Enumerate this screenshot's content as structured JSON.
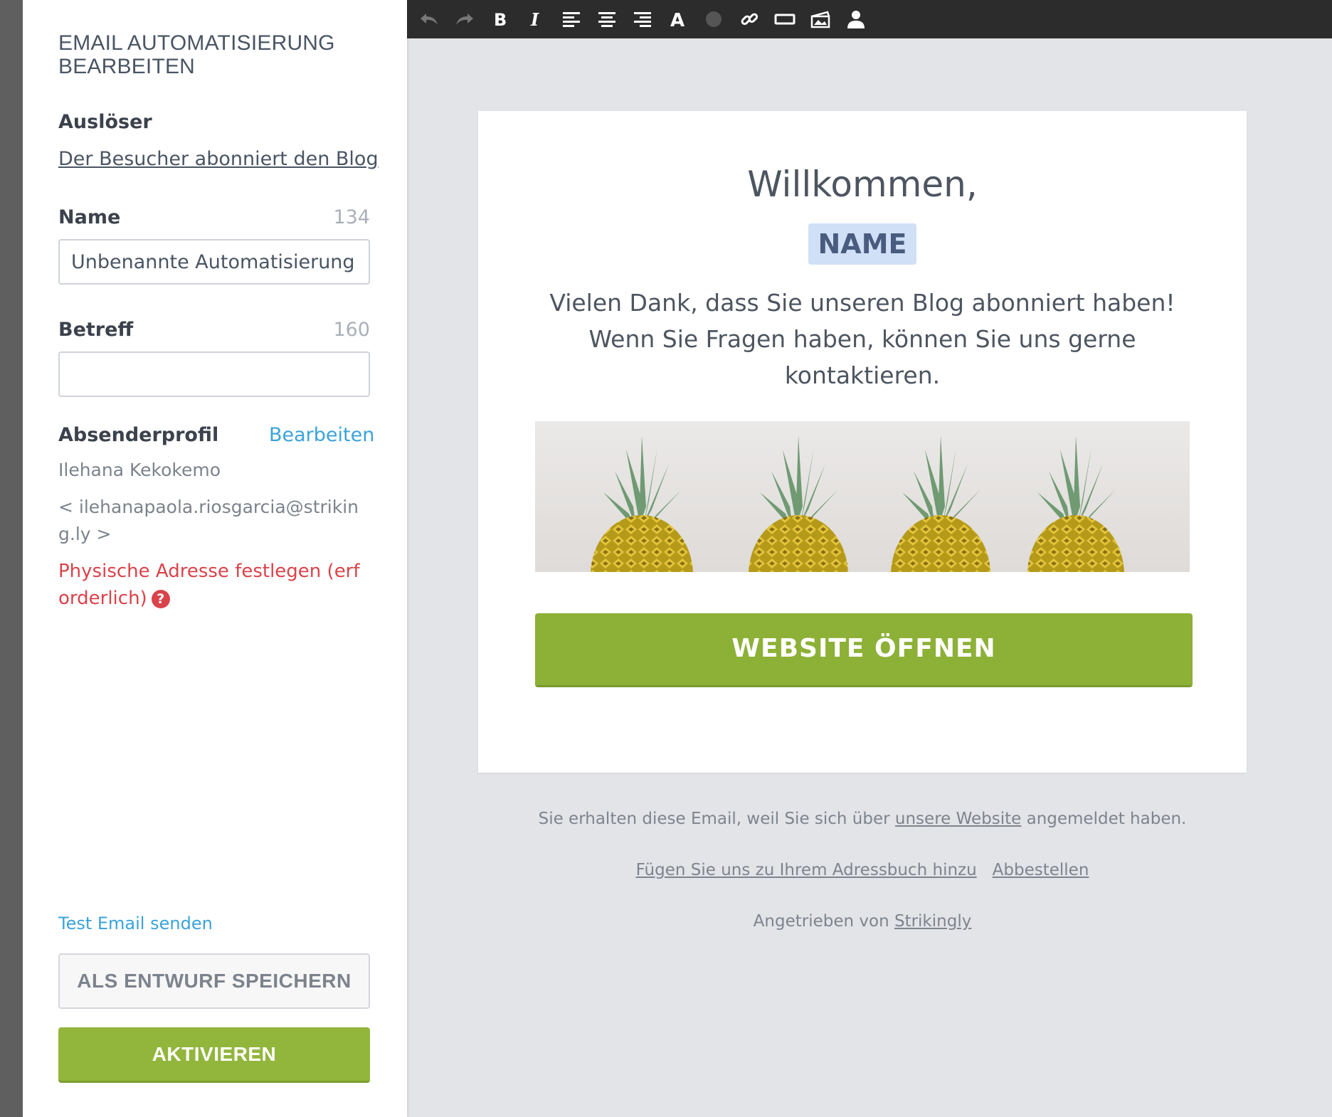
{
  "sidebar": {
    "title": "EMAIL AUTOMATISIERUNG BEARBEITEN",
    "trigger_label": "Auslöser",
    "trigger_value": "Der Besucher abonniert den Blog",
    "name_label": "Name",
    "name_count": "134",
    "name_value": "Unbenannte Automatisierung",
    "subject_label": "Betreff",
    "subject_count": "160",
    "subject_value": "",
    "sender_label": "Absenderprofil",
    "sender_edit": "Bearbeiten",
    "sender_name": "Ilehana Kekokemo",
    "sender_email": "< ilehanapaola.riosgarcia@striking.ly >",
    "address_warning": "Physische Adresse festlegen (erforderlich)",
    "test_email": "Test Email senden",
    "draft_button": "ALS ENTWURF SPEICHERN",
    "activate_button": "AKTIVIEREN"
  },
  "toolbar": {
    "buttons": [
      "undo-icon",
      "redo-icon",
      "bold-icon",
      "italic-icon",
      "align-left-icon",
      "align-center-icon",
      "align-right-icon",
      "font-color-icon",
      "color-dot-icon",
      "link-icon",
      "button-icon",
      "image-gallery-icon",
      "person-icon"
    ]
  },
  "email": {
    "greeting": "Willkommen,",
    "name_placeholder": "NAME",
    "body": "Vielen Dank, dass Sie unseren Blog abonniert haben! Wenn Sie Fragen haben, können Sie uns gerne kontaktieren.",
    "cta": "WEBSITE ÖFFNEN"
  },
  "footer": {
    "reason_prefix": "Sie erhalten diese Email, weil Sie sich über",
    "reason_link": "unsere Website",
    "reason_suffix": "angemeldet haben.",
    "addressbook_link": "Fügen Sie uns zu Ihrem Adressbuch hinzu",
    "unsubscribe_link": "Abbestellen",
    "powered_prefix": "Angetrieben von",
    "powered_link": "Strikingly"
  },
  "colors": {
    "accent_green": "#8db037",
    "link_blue": "#3ba3d9",
    "warning_red": "#d9434a",
    "toolbar_bg": "#2c2c2c"
  }
}
